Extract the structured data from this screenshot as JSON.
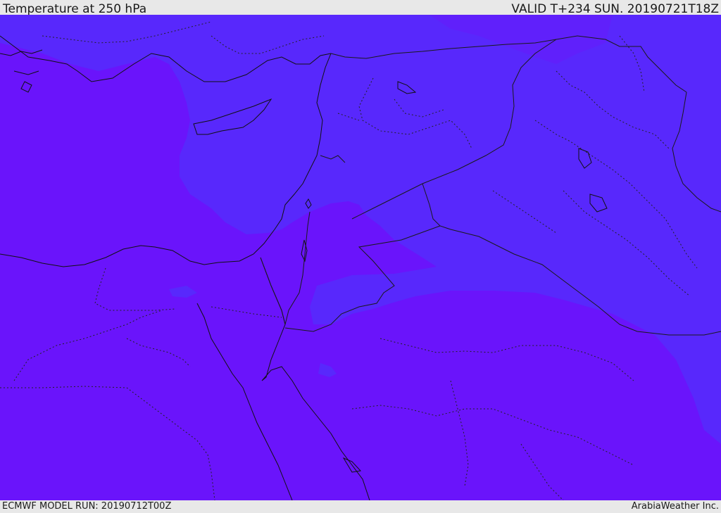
{
  "header": {
    "title": "Temperature at 250 hPa",
    "valid": "VALID T+234 SUN. 20190721T18Z"
  },
  "footer": {
    "model_run": "ECMWF MODEL RUN: 20190712T00Z",
    "credit": "ArabiaWeather Inc."
  },
  "map": {
    "field": "temperature",
    "level": "250 hPa",
    "colors": {
      "warm_fill": "#6a14fb",
      "cool_fill": "#5828fc",
      "coastline": "#111111",
      "border": "#222222"
    }
  }
}
